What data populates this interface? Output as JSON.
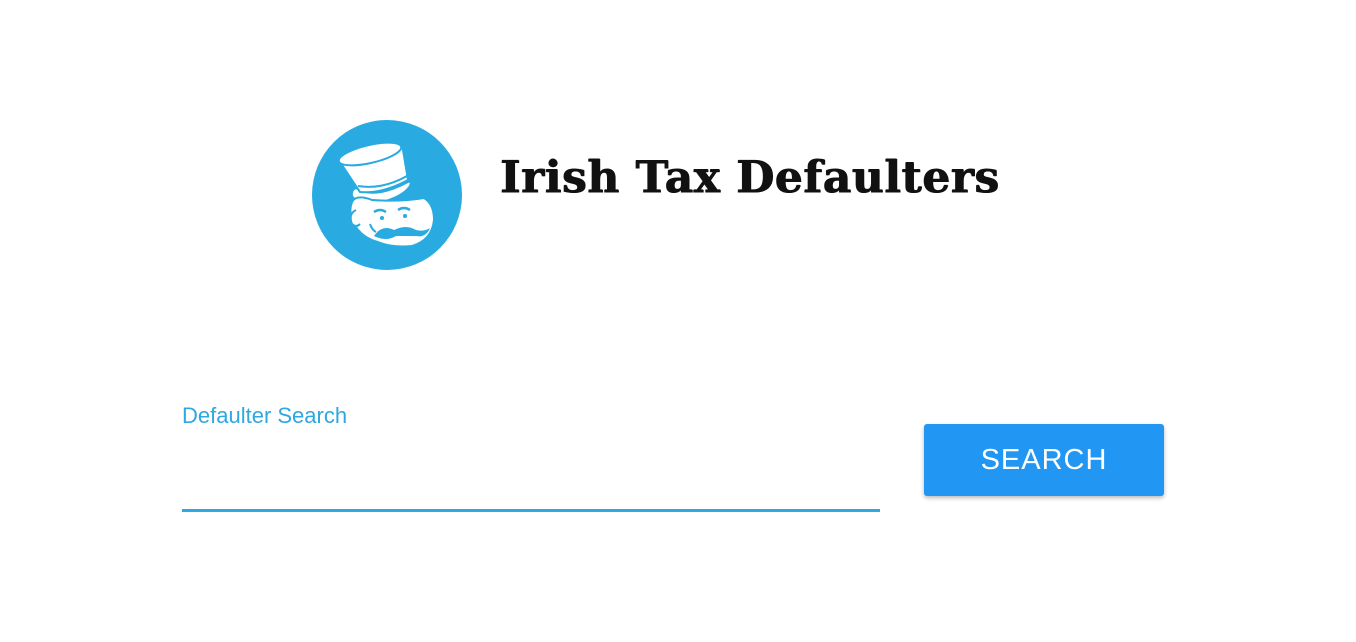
{
  "header": {
    "title": "Irish Tax Defaulters",
    "logo_icon": "monopoly-man-logo-icon",
    "logo_color": "#29abe2"
  },
  "search": {
    "label": "Defaulter Search",
    "value": "",
    "placeholder": "",
    "button_label": "SEARCH"
  },
  "colors": {
    "accent": "#2ea8e0",
    "button": "#2196f3",
    "button_text": "#ffffff",
    "title_text": "#111111"
  }
}
